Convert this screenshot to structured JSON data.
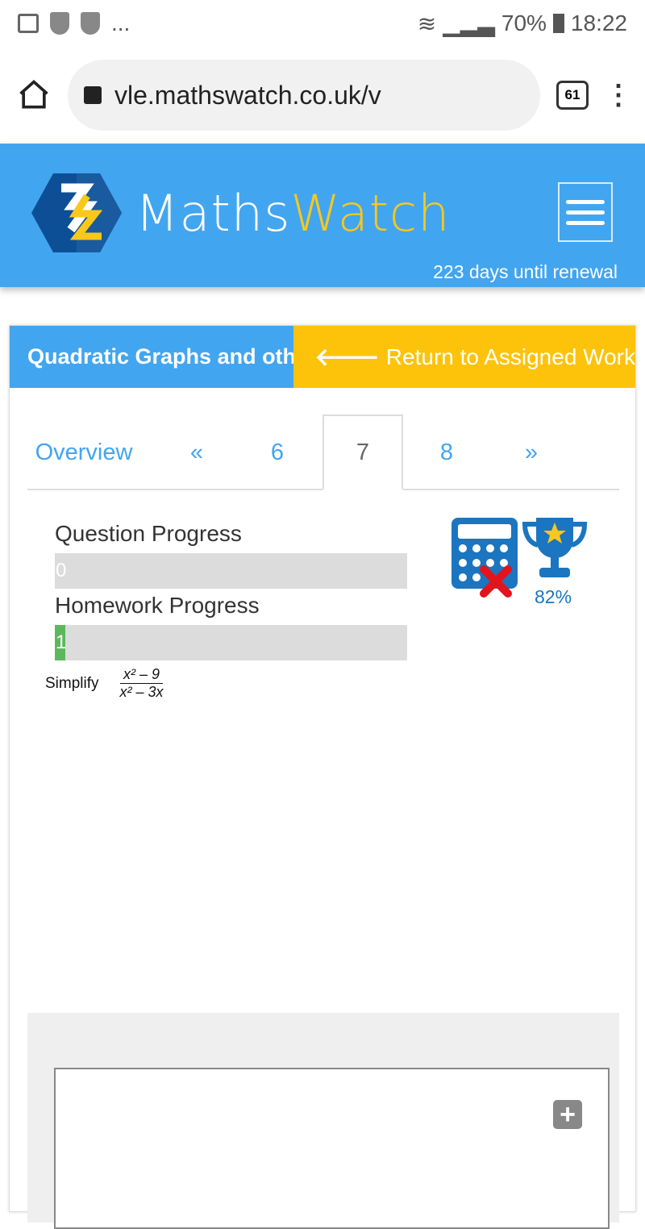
{
  "status_bar": {
    "battery": "70%",
    "time": "18:22",
    "more": "..."
  },
  "browser": {
    "url": "vle.mathswatch.co.uk/v",
    "tab_count": "61"
  },
  "header": {
    "brand_part1": "Maths",
    "brand_part2": "Watch",
    "renewal": "223 days until renewal",
    "brand_colors": {
      "blue": "#42a5f0",
      "yellow": "#f9c81a"
    }
  },
  "card": {
    "title": "Quadratic Graphs and other",
    "return_label": "Return to Assigned Work"
  },
  "nav": {
    "overview": "Overview",
    "prev": "«",
    "pages": [
      "6",
      "7",
      "8"
    ],
    "active": "7",
    "next": "»"
  },
  "progress": {
    "question_label": "Question Progress",
    "question_value": "0",
    "question_fraction": 0,
    "homework_label": "Homework Progress",
    "homework_value": "1",
    "homework_fraction": 0.03
  },
  "badges": {
    "calculator": "calculator-not-allowed-icon",
    "trophy_percent": "82%"
  },
  "question": {
    "prompt": "Simplify",
    "numerator": "x² – 9",
    "denominator": "x² – 3x"
  },
  "answer": {
    "add_label": "+"
  }
}
